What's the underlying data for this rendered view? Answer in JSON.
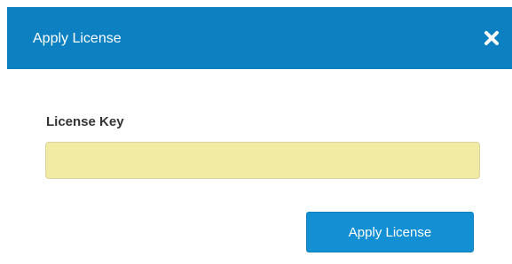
{
  "dialog": {
    "title": "Apply License",
    "close_icon": "close-x-icon"
  },
  "form": {
    "license_key_label": "License Key",
    "license_key_value": "",
    "license_key_placeholder": ""
  },
  "actions": {
    "apply_label": "Apply License"
  },
  "colors": {
    "header_bg": "#0c80c0",
    "input_bg": "#f2eba4",
    "button_bg": "#138fd3"
  }
}
